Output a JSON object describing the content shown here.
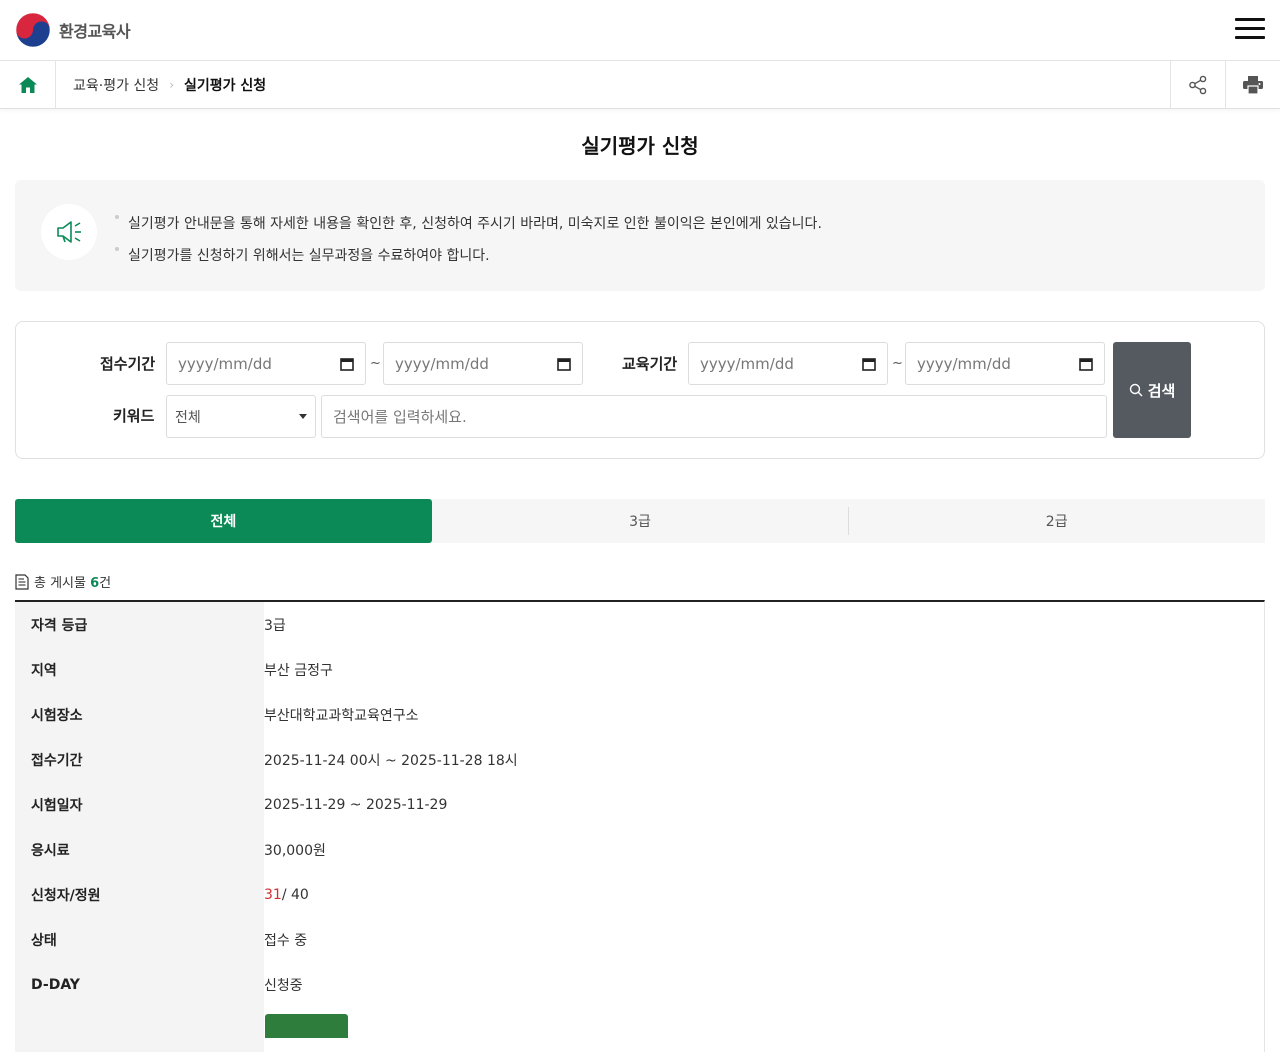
{
  "header": {
    "logo_text": "환경교육사"
  },
  "breadcrumb": {
    "level1": "교육·평가 신청",
    "level2": "실기평가 신청"
  },
  "page": {
    "title": "실기평가 신청"
  },
  "notice": {
    "items": [
      "실기평가 안내문을 통해 자세한 내용을 확인한 후, 신청하여 주시기 바라며, 미숙지로 인한 불이익은 본인에게 있습니다.",
      "실기평가를 신청하기 위해서는 실무과정을 수료하여야 합니다."
    ]
  },
  "search": {
    "reception_label": "접수기간",
    "education_label": "교육기간",
    "keyword_label": "키워드",
    "date_placeholder": "yyyy/mm/dd",
    "tilde": "~",
    "keyword_select": "전체",
    "keyword_placeholder": "검색어를 입력하세요.",
    "button_label": "검색"
  },
  "tabs": [
    {
      "label": "전체",
      "active": true
    },
    {
      "label": "3급",
      "active": false
    },
    {
      "label": "2급",
      "active": false
    }
  ],
  "count": {
    "prefix": "총 게시물 ",
    "value": "6",
    "suffix": "건"
  },
  "detail": {
    "rows": [
      {
        "label": "자격 등급",
        "value": "3급"
      },
      {
        "label": "지역",
        "value": "부산 금정구"
      },
      {
        "label": "시험장소",
        "value": "부산대학교과학교육연구소"
      },
      {
        "label": "접수기간",
        "value": "2025-11-24 00시 ~ 2025-11-28 18시"
      },
      {
        "label": "시험일자",
        "value": "2025-11-29 ~ 2025-11-29"
      },
      {
        "label": "응시료",
        "value": "30,000원"
      },
      {
        "label": "신청자/정원",
        "value_applicants": "31",
        "value_capacity": "/ 40"
      },
      {
        "label": "상태",
        "value": "접수 중"
      },
      {
        "label": "D-DAY",
        "value": "신청중"
      }
    ]
  },
  "colors": {
    "accent_green": "#0b8a58",
    "search_button": "#555a61",
    "applicant_red": "#d32f2f"
  }
}
